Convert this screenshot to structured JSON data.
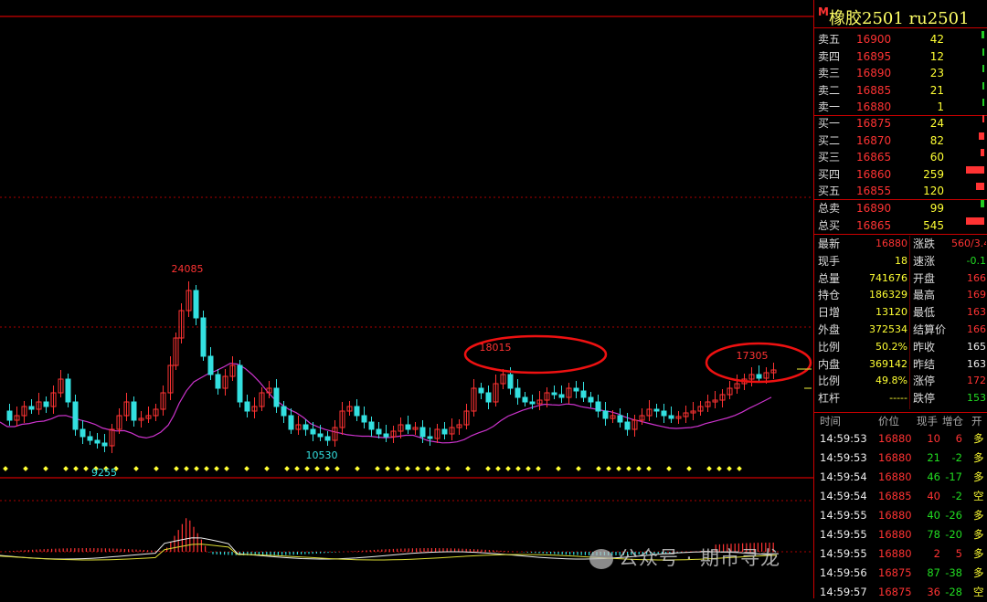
{
  "header": {
    "marker": "M",
    "title": "橡胶2501  ru2501"
  },
  "orderbook": {
    "asks": [
      {
        "label": "卖五",
        "price": "16900",
        "qty": "42",
        "level": 0.12
      },
      {
        "label": "卖四",
        "price": "16895",
        "qty": "12",
        "level": 0.05
      },
      {
        "label": "卖三",
        "price": "16890",
        "qty": "23",
        "level": 0.07
      },
      {
        "label": "卖二",
        "price": "16885",
        "qty": "21",
        "level": 0.06
      },
      {
        "label": "卖一",
        "price": "16880",
        "qty": "1",
        "level": 0.02
      }
    ],
    "bids": [
      {
        "label": "买一",
        "price": "16875",
        "qty": "24",
        "level": 0.06
      },
      {
        "label": "买二",
        "price": "16870",
        "qty": "82",
        "level": 0.25
      },
      {
        "label": "买三",
        "price": "16865",
        "qty": "60",
        "level": 0.18
      },
      {
        "label": "买四",
        "price": "16860",
        "qty": "259",
        "level": 0.85
      },
      {
        "label": "买五",
        "price": "16855",
        "qty": "120",
        "level": 0.38
      }
    ],
    "totals": [
      {
        "label": "总卖",
        "price": "16890",
        "qty": "99",
        "color": "green",
        "level": 0.15
      },
      {
        "label": "总买",
        "price": "16865",
        "qty": "545",
        "color": "red",
        "level": 0.85
      }
    ]
  },
  "stats": [
    {
      "l1": "最新",
      "v1": "16880",
      "c1": "red",
      "l2": "涨跌",
      "v2": "560/3.4",
      "c2": "red"
    },
    {
      "l1": "现手",
      "v1": "18",
      "c1": "yel",
      "l2": "速涨",
      "v2": "-0.1",
      "c2": "grn"
    },
    {
      "l1": "总量",
      "v1": "741676",
      "c1": "yel",
      "l2": "开盘",
      "v2": "166",
      "c2": "red"
    },
    {
      "l1": "持仓",
      "v1": "186329",
      "c1": "yel",
      "l2": "最高",
      "v2": "169",
      "c2": "red"
    },
    {
      "l1": "日增",
      "v1": "13120",
      "c1": "yel",
      "l2": "最低",
      "v2": "163",
      "c2": "red"
    },
    {
      "l1": "外盘",
      "v1": "372534",
      "c1": "yel",
      "l2": "结算价",
      "v2": "166",
      "c2": "red"
    },
    {
      "l1": "比例",
      "v1": "50.2%",
      "c1": "yel",
      "l2": "昨收",
      "v2": "165",
      "c2": "wht"
    },
    {
      "l1": "内盘",
      "v1": "369142",
      "c1": "yel",
      "l2": "昨结",
      "v2": "163",
      "c2": "wht"
    },
    {
      "l1": "比例",
      "v1": "49.8%",
      "c1": "yel",
      "l2": "涨停",
      "v2": "172",
      "c2": "red"
    },
    {
      "l1": "杠杆",
      "v1": "-----",
      "c1": "yel",
      "l2": "跌停",
      "v2": "153",
      "c2": "grn"
    }
  ],
  "trades_header": [
    "时间",
    "价位",
    "现手",
    "增仓",
    "开"
  ],
  "trades": [
    {
      "time": "14:59:53",
      "price": "16880",
      "hand": "10",
      "chg": "6",
      "type": "多",
      "hc": "red",
      "cc": "red"
    },
    {
      "time": "14:59:53",
      "price": "16880",
      "hand": "21",
      "chg": "-2",
      "type": "多",
      "hc": "grn",
      "cc": "grn"
    },
    {
      "time": "14:59:54",
      "price": "16880",
      "hand": "46",
      "chg": "-17",
      "type": "多",
      "hc": "grn",
      "cc": "grn"
    },
    {
      "time": "14:59:54",
      "price": "16885",
      "hand": "40",
      "chg": "-2",
      "type": "空",
      "hc": "red",
      "cc": "grn"
    },
    {
      "time": "14:59:55",
      "price": "16880",
      "hand": "40",
      "chg": "-26",
      "type": "多",
      "hc": "grn",
      "cc": "grn"
    },
    {
      "time": "14:59:55",
      "price": "16880",
      "hand": "78",
      "chg": "-20",
      "type": "多",
      "hc": "grn",
      "cc": "grn"
    },
    {
      "time": "14:59:55",
      "price": "16880",
      "hand": "2",
      "chg": "5",
      "type": "多",
      "hc": "red",
      "cc": "red"
    },
    {
      "time": "14:59:56",
      "price": "16875",
      "hand": "87",
      "chg": "-38",
      "type": "多",
      "hc": "grn",
      "cc": "grn"
    },
    {
      "time": "14:59:57",
      "price": "16875",
      "hand": "36",
      "chg": "-28",
      "type": "空",
      "hc": "red",
      "cc": "grn"
    }
  ],
  "chart_labels": {
    "high": "24085",
    "low1": "9255",
    "low2": "10530",
    "peak1": "18015",
    "peak2": "17305"
  },
  "watermark": "公众号 · 期市寻龙",
  "colors": {
    "up": "#ff3333",
    "down": "#33e0e0",
    "ma": "#cc33cc",
    "grid": "#aa0000",
    "signal": "#ffff33"
  }
}
